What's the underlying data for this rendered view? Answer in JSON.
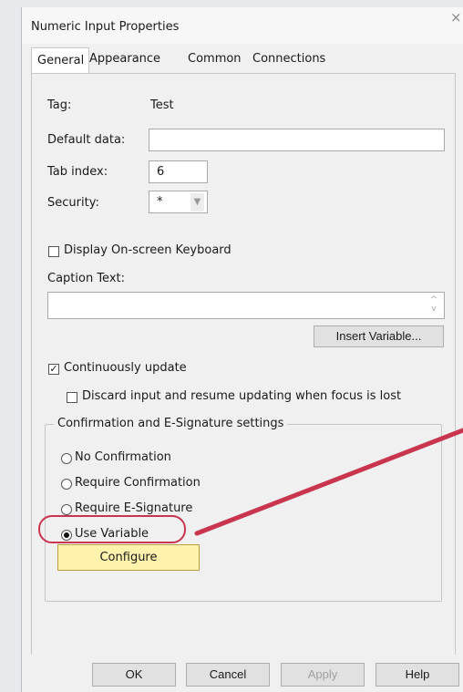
{
  "dialog": {
    "title": "Numeric Input Properties",
    "close_glyph": "×"
  },
  "tabs": [
    {
      "label": "General",
      "active": true
    },
    {
      "label": "Appearance",
      "active": false
    },
    {
      "label": "Common",
      "active": false
    },
    {
      "label": "Connections",
      "active": false
    }
  ],
  "general": {
    "tag_label": "Tag:",
    "tag_value": "Test",
    "default_data_label": "Default data:",
    "default_data_value": "",
    "tab_index_label": "Tab index:",
    "tab_index_value": "6",
    "security_label": "Security:",
    "security_value": "*",
    "display_keyboard_label": "Display On-screen Keyboard",
    "display_keyboard_checked": false,
    "caption_text_label": "Caption Text:",
    "caption_text_value": "",
    "insert_variable_label": "Insert Variable...",
    "continuously_update_label": "Continuously update",
    "continuously_update_checked": true,
    "discard_input_label": "Discard input and resume updating when focus is lost",
    "discard_input_checked": false
  },
  "confirmation": {
    "group_title": "Confirmation and E-Signature settings",
    "options": [
      {
        "label": "No Confirmation",
        "selected": false
      },
      {
        "label": "Require Confirmation",
        "selected": false
      },
      {
        "label": "Require E-Signature",
        "selected": false
      },
      {
        "label": "Use Variable",
        "selected": true
      }
    ],
    "configure_label": "Configure"
  },
  "footer": {
    "ok_label": "OK",
    "cancel_label": "Cancel",
    "apply_label": "Apply",
    "help_label": "Help"
  },
  "colors": {
    "annotation": "#c9344f",
    "configure_bg": "#fff2ad"
  },
  "icons": {
    "close": "close-icon",
    "checkmark": "checkmark-icon",
    "dropdown": "chevron-down-icon",
    "spinner": "spinner-arrows-icon"
  }
}
